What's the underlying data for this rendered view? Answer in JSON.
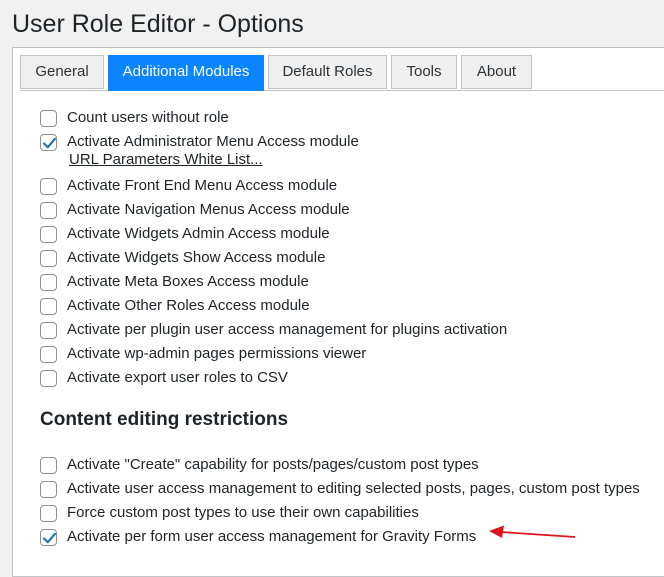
{
  "page": {
    "title": "User Role Editor - Options"
  },
  "tabs": [
    {
      "label": "General",
      "active": false
    },
    {
      "label": "Additional Modules",
      "active": true
    },
    {
      "label": "Default Roles",
      "active": false
    },
    {
      "label": "Tools",
      "active": false
    },
    {
      "label": "About",
      "active": false
    }
  ],
  "modules": {
    "items": [
      {
        "label": "Count users without role",
        "checked": false
      },
      {
        "label": "Activate Administrator Menu Access module",
        "checked": true
      },
      {
        "label": "Activate Front End Menu Access module",
        "checked": false
      },
      {
        "label": "Activate Navigation Menus Access module",
        "checked": false
      },
      {
        "label": "Activate Widgets Admin Access module",
        "checked": false
      },
      {
        "label": "Activate Widgets Show Access module",
        "checked": false
      },
      {
        "label": "Activate Meta Boxes Access module",
        "checked": false
      },
      {
        "label": "Activate Other Roles Access module",
        "checked": false
      },
      {
        "label": "Activate per plugin user access management for plugins activation",
        "checked": false
      },
      {
        "label": "Activate wp-admin pages permissions viewer",
        "checked": false
      },
      {
        "label": "Activate export user roles to CSV",
        "checked": false
      }
    ],
    "url_params_link": "URL Parameters White List..."
  },
  "content_restrictions": {
    "title": "Content editing restrictions",
    "items": [
      {
        "label": "Activate \"Create\" capability for posts/pages/custom post types",
        "checked": false
      },
      {
        "label": "Activate user access management to editing selected posts, pages, custom post types",
        "checked": false
      },
      {
        "label": "Force custom post types to use their own capabilities",
        "checked": false
      },
      {
        "label": "Activate per form user access management for Gravity Forms",
        "checked": true
      }
    ]
  },
  "colors": {
    "accent": "#0a84ff",
    "checkmark": "#2271b1",
    "annotation_arrow": "#e0141e"
  },
  "icons": {
    "checkmark": "checkmark-icon",
    "annotation": "red-arrow-icon"
  }
}
